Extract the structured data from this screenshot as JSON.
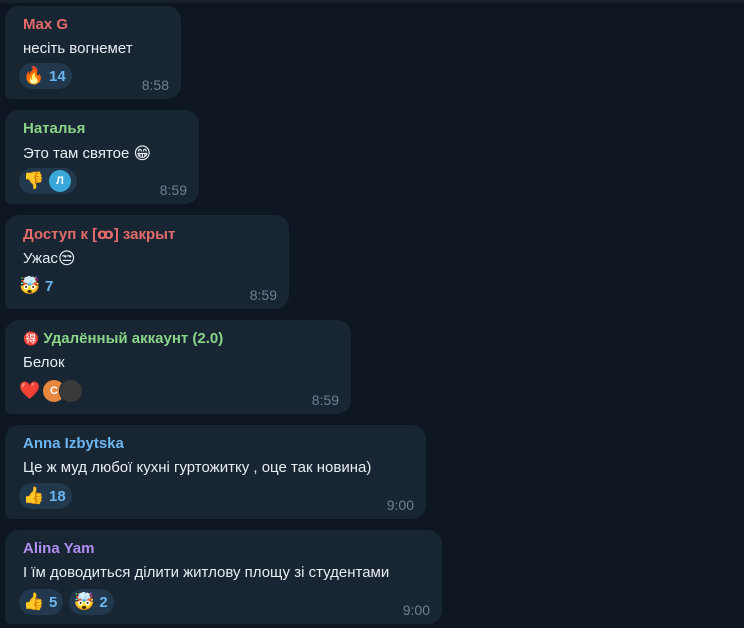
{
  "messages": [
    {
      "sender": "Max G",
      "sender_color": "#e56a6a",
      "text": "несіть вогнемет",
      "time": "8:58",
      "reactions": [
        {
          "emoji": "🔥",
          "icon": "fire-icon",
          "count": "14"
        }
      ]
    },
    {
      "sender": "Наталья",
      "sender_color": "#8ad488",
      "text": "Это там святое",
      "text_emoji": "😁",
      "time": "8:59",
      "reactions": [
        {
          "emoji": "👎",
          "icon": "thumbs-down-icon",
          "avatar_letter": "Л",
          "avatar_color": "#3ba7d9"
        }
      ]
    },
    {
      "sender": "Доступ к [ꝏ] закрыт",
      "sender_color": "#e56a6a",
      "text": "Ужас",
      "text_emoji": "😒",
      "time": "8:59",
      "reactions": [
        {
          "emoji": "🤯",
          "icon": "exploding-head-icon",
          "count": "7"
        }
      ]
    },
    {
      "sender_badge": "🉐",
      "sender": "Удалённый аккаунт (2.0)",
      "sender_color": "#8ad488",
      "text": "Белок",
      "time": "8:59",
      "reactions": [
        {
          "emoji": "❤️",
          "icon": "heart-icon",
          "avatar_letter": "С",
          "avatar_color": "#e8873f",
          "avatar2_color": "#3a3a3a"
        }
      ]
    },
    {
      "sender": "Anna Izbytska",
      "sender_color": "#6cb6f0",
      "text": "Це ж муд любої кухні гуртожитку , оце так новина)",
      "time": "9:00",
      "reactions": [
        {
          "emoji": "👍",
          "icon": "thumbs-up-icon",
          "count": "18"
        }
      ]
    },
    {
      "sender": "Alina Yam",
      "sender_color": "#b08ef0",
      "text": "І їм доводиться ділити житлову площу зі студентами",
      "time": "9:00",
      "reactions": [
        {
          "emoji": "👍",
          "icon": "thumbs-up-icon",
          "count": "5"
        },
        {
          "emoji": "🤯",
          "icon": "exploding-head-icon",
          "count": "2"
        }
      ]
    }
  ]
}
